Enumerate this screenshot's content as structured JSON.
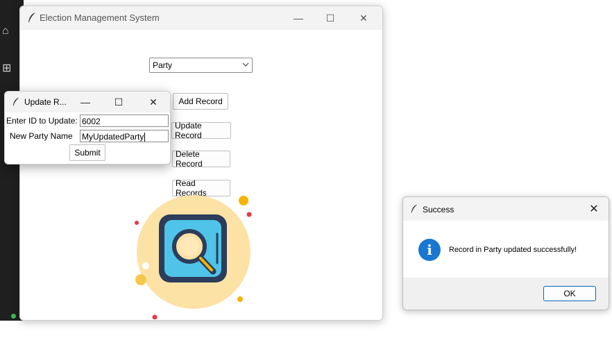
{
  "main_window": {
    "title": "Election Management System",
    "minimize": "—",
    "maximize": "☐",
    "close": "✕",
    "table_select": {
      "selected": "Party"
    },
    "buttons": {
      "add": "Add Record",
      "update": "Update Record",
      "delete": "Delete Record",
      "read": "Read Records"
    }
  },
  "update_dialog": {
    "title": "Update R...",
    "minimize": "—",
    "maximize": "☐",
    "close": "✕",
    "id_label": "Enter ID to Update:",
    "id_value": "6002",
    "name_label": "New Party Name",
    "name_value": "MyUpdatedParty",
    "submit": "Submit"
  },
  "success_dialog": {
    "title": "Success",
    "close": "✕",
    "message": "Record in Party updated successfully!",
    "ok": "OK",
    "icon": "info-icon"
  },
  "colors": {
    "info_blue": "#1976d2",
    "illustration_circle": "#fde2a6",
    "illustration_frame": "#2b3d5a",
    "illustration_fill": "#4fc3e8"
  }
}
